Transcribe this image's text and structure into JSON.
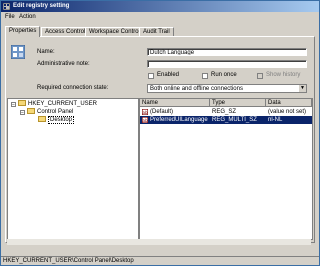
{
  "window": {
    "title": "Edit registry setting"
  },
  "menu": {
    "items": [
      {
        "label": "File"
      },
      {
        "label": "Action"
      }
    ]
  },
  "tabs": [
    {
      "label": "Properties",
      "active": true
    },
    {
      "label": "Access Control",
      "active": false
    },
    {
      "label": "Workspace Control",
      "active": false
    },
    {
      "label": "Audit Trail",
      "active": false
    }
  ],
  "properties": {
    "name_label": "Name:",
    "name_value": "Dutch Language",
    "admin_note_label": "Administrative note:",
    "admin_note_value": "",
    "enabled_label": "Enabled",
    "enabled_checked": false,
    "run_once_label": "Run once",
    "run_once_checked": false,
    "show_history_label": "Show history",
    "show_history_enabled": false,
    "required_state_label": "Required connection state:",
    "required_state_value": "Both online and offline connections"
  },
  "tree": {
    "nodes": [
      {
        "label": "HKEY_CURRENT_USER",
        "level": 0,
        "expanded": true
      },
      {
        "label": "Control Panel",
        "level": 1,
        "expanded": true
      },
      {
        "label": "Desktop",
        "level": 2,
        "selected": true
      }
    ]
  },
  "list": {
    "columns": [
      {
        "label": "Name"
      },
      {
        "label": "Type"
      },
      {
        "label": "Data"
      }
    ],
    "rows": [
      {
        "name": "(Default)",
        "type": "REG_SZ",
        "data": "(value not set)",
        "selected": false,
        "icon": "string-value-icon"
      },
      {
        "name": "PreferredUILanguages",
        "type": "REG_MULTI_SZ",
        "data": "nl-NL",
        "selected": true,
        "icon": "multi-string-value-icon"
      }
    ]
  },
  "status": {
    "path": "HKEY_CURRENT_USER\\Control Panel\\Desktop"
  },
  "colors": {
    "title_start": "#0a246a",
    "title_end": "#a6caf0",
    "selection": "#0a246a",
    "face": "#d4d0c8"
  }
}
